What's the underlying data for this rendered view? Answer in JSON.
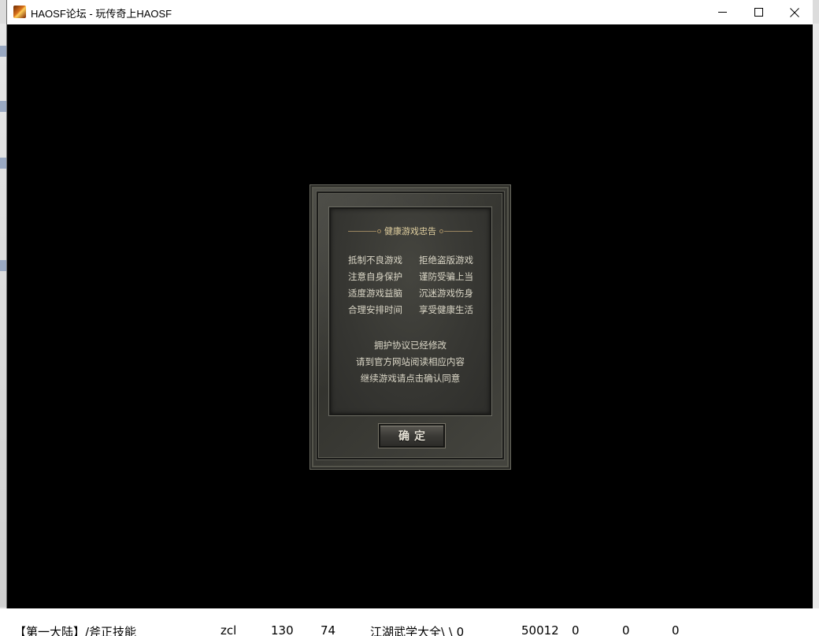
{
  "window": {
    "title": "HAOSF论坛 - 玩传奇上HAOSF"
  },
  "dialog": {
    "title": "健康游戏忠告",
    "slogans": [
      "抵制不良游戏",
      "拒绝盗版游戏",
      "注意自身保护",
      "谨防受骗上当",
      "适度游戏益脑",
      "沉迷游戏伤身",
      "合理安排时间",
      "享受健康生活"
    ],
    "notices": [
      "拥护协议已经修改",
      "请到官方网站阅读相应内容",
      "继续游戏请点击确认同意"
    ],
    "confirm_label": "确定"
  },
  "background": {
    "bottom_row": [
      "【第一大陆】/斧正技能",
      "zcl",
      "130",
      "74",
      "江湖武学大全\\ \\ 0",
      "50012",
      "0",
      "0",
      "0"
    ]
  }
}
